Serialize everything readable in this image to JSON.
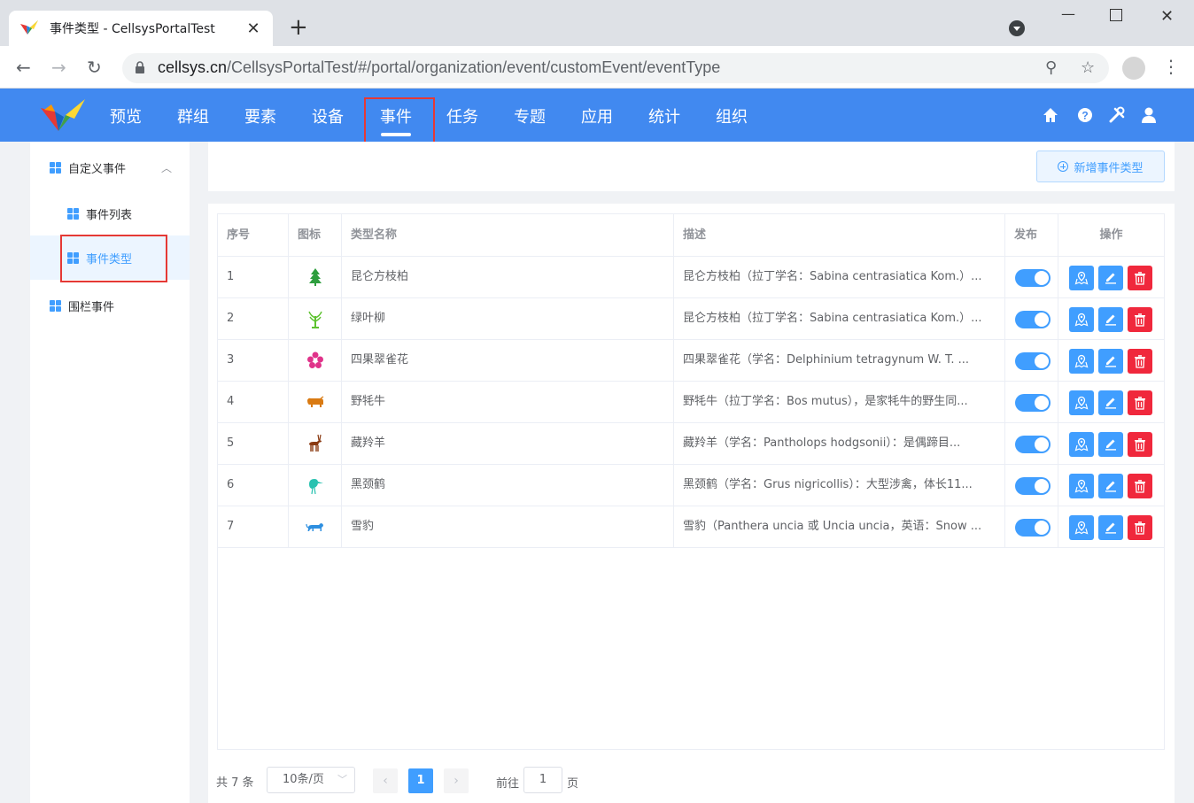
{
  "browser": {
    "tab_title": "事件类型 - CellsysPortalTest",
    "url_host": "cellsys.cn",
    "url_path": "/CellsysPortalTest/#/portal/organization/event/customEvent/eventType"
  },
  "nav": {
    "items": [
      "预览",
      "群组",
      "要素",
      "设备",
      "事件",
      "任务",
      "专题",
      "应用",
      "统计",
      "组织"
    ],
    "active_index": 4
  },
  "sidebar": {
    "group_label": "自定义事件",
    "sub_items": [
      "事件列表",
      "事件类型"
    ],
    "active_sub_index": 1,
    "other_item": "围栏事件"
  },
  "toolbar": {
    "add_label": "新增事件类型"
  },
  "table": {
    "headers": [
      "序号",
      "图标",
      "类型名称",
      "描述",
      "发布",
      "操作"
    ],
    "rows": [
      {
        "no": "1",
        "icon": "tree-icon",
        "icon_color": "#2e9e3e",
        "name": "昆仑方枝柏",
        "desc": "昆仑方枝柏（拉丁学名：Sabina centrasiatica Kom.）...",
        "published": true
      },
      {
        "no": "2",
        "icon": "willow-icon",
        "icon_color": "#5dc22f",
        "name": "绿叶柳",
        "desc": "昆仑方枝柏（拉丁学名：Sabina centrasiatica Kom.）...",
        "published": true
      },
      {
        "no": "3",
        "icon": "flower-icon",
        "icon_color": "#e0338a",
        "name": "四果翠雀花",
        "desc": "四果翠雀花（学名：Delphinium tetragynum W. T. ...",
        "published": true
      },
      {
        "no": "4",
        "icon": "yak-icon",
        "icon_color": "#d97a12",
        "name": "野牦牛",
        "desc": "野牦牛（拉丁学名：Bos mutus），是家牦牛的野生同...",
        "published": true
      },
      {
        "no": "5",
        "icon": "antelope-icon",
        "icon_color": "#8a3a12",
        "name": "藏羚羊",
        "desc": "藏羚羊（学名：Pantholops hodgsonii）：是偶蹄目...",
        "published": true
      },
      {
        "no": "6",
        "icon": "crane-icon",
        "icon_color": "#28c2b0",
        "name": "黑颈鹤",
        "desc": "黑颈鹤（学名：Grus nigricollis）：大型涉禽，体长11...",
        "published": true
      },
      {
        "no": "7",
        "icon": "leopard-icon",
        "icon_color": "#2e8fe0",
        "name": "雪豹",
        "desc": "雪豹（Panthera uncia 或 Uncia uncia，英语：Snow ...",
        "published": true
      }
    ]
  },
  "pagination": {
    "total": "共 7 条",
    "page_size": "10条/页",
    "current_page": "1",
    "goto_prefix": "前往",
    "goto_value": "1",
    "goto_suffix": "页"
  },
  "colors": {
    "header_blue": "#4189f0",
    "primary": "#409eff",
    "danger": "#f0283c",
    "highlight_red": "#e53935"
  }
}
